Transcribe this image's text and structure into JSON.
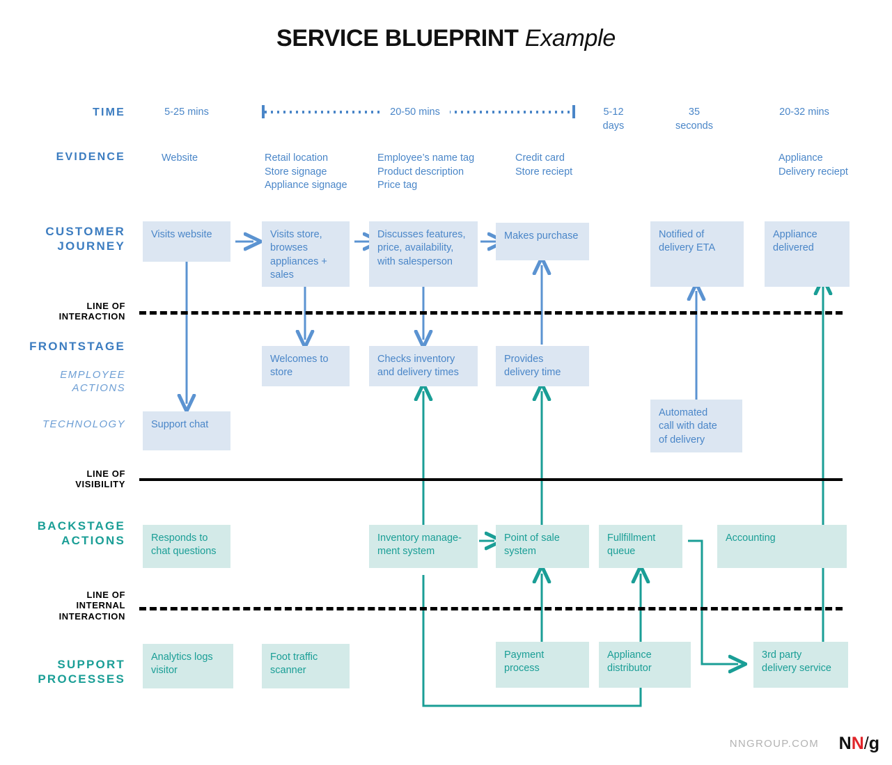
{
  "title": {
    "bold": "SERVICE BLUEPRINT",
    "italic": "Example"
  },
  "footer": {
    "url": "NNGROUP.COM",
    "logo_n1": "N",
    "logo_n2": "N",
    "logo_slash": "/",
    "logo_g": "g"
  },
  "colors": {
    "blue_text": "#4a86c8",
    "blue_label": "#3b7cc0",
    "blue_box_fill": "#dce6f2",
    "blue_arrow": "#5b93d1",
    "teal_text": "#1a9e96",
    "teal_box_fill": "#d3eae8",
    "teal_arrow": "#1a9e96",
    "line_black": "#000000",
    "footer_grey": "#b3b3b3",
    "logo_red": "#e0252a"
  },
  "rows": {
    "time": {
      "label": "TIME"
    },
    "evidence": {
      "label": "EVIDENCE"
    },
    "customer_journey": {
      "label_line1": "CUSTOMER",
      "label_line2": "JOURNEY"
    },
    "line_of_interaction": {
      "label_line1": "LINE OF",
      "label_line2": "INTERACTION"
    },
    "frontstage": {
      "label": "FRONTSTAGE"
    },
    "employee_actions": {
      "label_line1": "EMPLOYEE",
      "label_line2": "ACTIONS"
    },
    "technology": {
      "label": "TECHNOLOGY"
    },
    "line_of_visibility": {
      "label_line1": "LINE OF",
      "label_line2": "VISIBILITY"
    },
    "backstage_actions": {
      "label_line1": "BACKSTAGE",
      "label_line2": "ACTIONS"
    },
    "line_of_internal_interaction": {
      "label_line1": "LINE OF",
      "label_line2": "INTERNAL",
      "label_line3": "INTERACTION"
    },
    "support_processes": {
      "label_line1": "SUPPORT",
      "label_line2": "PROCESSES"
    }
  },
  "time_values": [
    {
      "id": "t1",
      "text": "5-25 mins"
    },
    {
      "id": "t2",
      "text": "20-50 mins",
      "has_dotted_span": true
    },
    {
      "id": "t3",
      "line1": "5-12",
      "line2": "days"
    },
    {
      "id": "t4",
      "line1": "35",
      "line2": "seconds"
    },
    {
      "id": "t5",
      "text": "20-32 mins"
    }
  ],
  "evidence_groups": [
    {
      "id": "e1",
      "items": [
        "Website"
      ]
    },
    {
      "id": "e2",
      "items": [
        "Retail location",
        "Store signage",
        "Appliance signage"
      ]
    },
    {
      "id": "e3",
      "items": [
        "Employee’s name tag",
        "Product description",
        "Price tag"
      ]
    },
    {
      "id": "e4",
      "items": [
        "Credit card",
        "Store reciept"
      ]
    },
    {
      "id": "e5",
      "items": [
        "Appliance",
        "Delivery reciept"
      ]
    }
  ],
  "customer_journey_boxes": [
    {
      "id": "cj1",
      "lines": [
        "Visits website"
      ]
    },
    {
      "id": "cj2",
      "lines": [
        "Visits store,",
        "browses",
        "appliances +",
        "sales"
      ]
    },
    {
      "id": "cj3",
      "lines": [
        "Discusses features,",
        "price, availability,",
        "with salesperson"
      ]
    },
    {
      "id": "cj4",
      "lines": [
        "Makes purchase"
      ]
    },
    {
      "id": "cj5",
      "lines": [
        "Notified of",
        "delivery ETA"
      ]
    },
    {
      "id": "cj6",
      "lines": [
        "Appliance",
        "delivered"
      ]
    }
  ],
  "employee_action_boxes": [
    {
      "id": "ea1",
      "lines": [
        "Welcomes to",
        "store"
      ]
    },
    {
      "id": "ea2",
      "lines": [
        "Checks inventory",
        "and delivery times"
      ]
    },
    {
      "id": "ea3",
      "lines": [
        "Provides",
        "delivery time"
      ]
    }
  ],
  "technology_boxes": [
    {
      "id": "tech1",
      "lines": [
        "Support chat"
      ]
    },
    {
      "id": "tech2",
      "lines": [
        "Automated",
        "call with date",
        "of delivery"
      ]
    }
  ],
  "backstage_boxes": [
    {
      "id": "bs1",
      "lines": [
        "Responds to",
        "chat questions"
      ]
    },
    {
      "id": "bs2",
      "lines": [
        "Inventory manage-",
        "ment system"
      ]
    },
    {
      "id": "bs3",
      "lines": [
        "Point of sale",
        "system"
      ]
    },
    {
      "id": "bs4",
      "lines": [
        "Fullfillment",
        "queue"
      ]
    },
    {
      "id": "bs5",
      "lines": [
        "Accounting"
      ]
    }
  ],
  "support_boxes": [
    {
      "id": "sp1",
      "lines": [
        "Analytics logs",
        "visitor"
      ]
    },
    {
      "id": "sp2",
      "lines": [
        "Foot traffic",
        "scanner"
      ]
    },
    {
      "id": "sp3",
      "lines": [
        "Payment",
        "process"
      ]
    },
    {
      "id": "sp4",
      "lines": [
        "Appliance",
        "distributor"
      ]
    },
    {
      "id": "sp5",
      "lines": [
        "3rd party",
        "delivery service"
      ]
    }
  ]
}
